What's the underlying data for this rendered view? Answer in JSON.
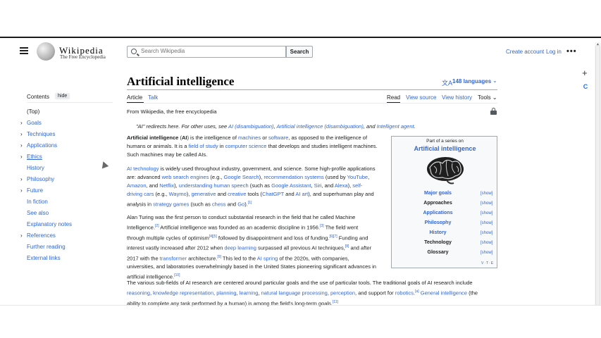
{
  "header": {
    "logo_word": "Wikipedia",
    "logo_tagline": "The Free Encyclopedia",
    "search_placeholder": "Search Wikipedia",
    "search_button": "Search",
    "create_account": "Create account",
    "login": "Log in",
    "more": "•••"
  },
  "side_tools": {
    "plus": "+",
    "extension": "C"
  },
  "toc": {
    "heading": "Contents",
    "hide": "hide",
    "items": [
      {
        "label": "(Top)",
        "expandable": false
      },
      {
        "label": "Goals",
        "expandable": true
      },
      {
        "label": "Techniques",
        "expandable": true
      },
      {
        "label": "Applications",
        "expandable": true
      },
      {
        "label": "Ethics",
        "expandable": true
      },
      {
        "label": "History",
        "expandable": false
      },
      {
        "label": "Philosophy",
        "expandable": true
      },
      {
        "label": "Future",
        "expandable": true
      },
      {
        "label": "In fiction",
        "expandable": false
      },
      {
        "label": "See also",
        "expandable": false
      },
      {
        "label": "Explanatory notes",
        "expandable": false
      },
      {
        "label": "References",
        "expandable": true
      },
      {
        "label": "Further reading",
        "expandable": false
      },
      {
        "label": "External links",
        "expandable": false
      }
    ]
  },
  "article": {
    "title": "Artificial intelligence",
    "languages": "148 languages",
    "tabs": {
      "article": "Article",
      "talk": "Talk",
      "read": "Read",
      "view_source": "View source",
      "view_history": "View history",
      "tools": "Tools"
    },
    "from": "From Wikipedia, the free encyclopedia",
    "hatnote": {
      "prefix": "\"AI\" redirects here. For other uses, see ",
      "link1": "AI (disambiguation)",
      "sep1": ", ",
      "link2": "Artificial intelligence (disambiguation)",
      "sep2": ", and ",
      "link3": "Intelligent agent",
      "suffix": "."
    },
    "p1": {
      "bold": "Artificial intelligence",
      "t1": " (",
      "bold2": "AI",
      "t2": ") is the intelligence of ",
      "l1": "machines",
      "t3": " or ",
      "l2": "software",
      "t4": ", as opposed to the intelligence of",
      "t5": "humans or animals. It is a ",
      "l3": "field of study",
      "t6": " in ",
      "l4": "computer science",
      "t7": " that develops and studies intelligent machines.",
      "t8": "Such machines may be called AIs."
    },
    "p2": {
      "l1": "AI technology",
      "t1": " is widely used throughout industry, government, and science. Some high-profile applications",
      "t2": "are: advanced ",
      "l2": "web search engines",
      "t3": " (e.g., ",
      "l3": "Google Search",
      "t4": "), ",
      "l4": "recommendation systems",
      "t5": " (used by ",
      "l5": "YouTube",
      "t6": ",",
      "l6": "Amazon",
      "t7": ", and ",
      "l7": "Netflix",
      "t8": "), ",
      "l8": "understanding human speech",
      "t9": " (such as ",
      "l9": "Google Assistant",
      "t10": ", ",
      "l10": "Siri",
      "t11": ", and ",
      "l11": "Alexa",
      "t12": "), ",
      "l12": "self-",
      "l13": "driving cars",
      "t13": " (e.g., ",
      "l14": "Waymo",
      "t14": "), ",
      "l15": "generative",
      "t15": " and ",
      "l16": "creative",
      "t16": " tools (",
      "l17": "ChatGPT",
      "t17": " and ",
      "l18": "AI art",
      "t18": "), and superhuman play and",
      "t19": "analysis in ",
      "l19": "strategy games",
      "t20": " (such as ",
      "l20": "chess",
      "t21": " and ",
      "l21": "Go",
      "t22": ").",
      "ref": "[1]"
    },
    "p3": {
      "t1": "Alan Turing was the first person to conduct substantial research in the field that he called Machine",
      "t2": "Intelligence.",
      "r1": "[2]",
      "t3": " Artificial intelligence was founded as an academic discipline in 1956.",
      "r2": "[3]",
      "t4": " The field went",
      "t5": "through multiple cycles of optimism",
      "r3": "[4][5]",
      "t6": " followed by disappointment and loss of funding.",
      "r4": "[6][7]",
      "t7": " Funding and",
      "t8": "interest vastly increased after 2012 when ",
      "l1": "deep learning",
      "t9": " surpassed all previous AI techniques,",
      "r5": "[8]",
      "t10": " and after",
      "t11": "2017 with the ",
      "l2": "transformer",
      "t12": " architecture.",
      "r6": "[9]",
      "t13": " This led to the ",
      "l3": "AI spring",
      "t14": " of the 2020s, with companies,",
      "t15": "universities, and laboratories overwhelmingly based in the United States pioneering significant advances in",
      "t16": "artificial intelligence.",
      "r7": "[10]"
    },
    "p4": {
      "t1": "The various sub-fields of AI research are centered around particular goals and the use of particular tools. The traditional goals of AI research include",
      "l1": "reasoning",
      "s1": ", ",
      "l2": "knowledge representation",
      "s2": ", ",
      "l3": "planning",
      "s3": ", ",
      "l4": "learning",
      "s4": ", ",
      "l5": "natural language processing",
      "s5": ", ",
      "l6": "perception",
      "t2": ", and support for ",
      "l7": "robotics",
      "t3": ".",
      "r1": "[a]",
      "l8": "General intelligence",
      "t4": " (the",
      "t5": "ability to complete any task performed by a human) is among the field's long-term goals.",
      "r2": "[11]"
    }
  },
  "infobox": {
    "series": "Part of a series on",
    "title": "Artificial intelligence",
    "rows": [
      {
        "label": "Major goals",
        "show": "[show]",
        "link": true
      },
      {
        "label": "Approaches",
        "show": "[show]",
        "link": false
      },
      {
        "label": "Applications",
        "show": "[show]",
        "link": true
      },
      {
        "label": "Philosophy",
        "show": "[show]",
        "link": true
      },
      {
        "label": "History",
        "show": "[show]",
        "link": true
      },
      {
        "label": "Technology",
        "show": "[show]",
        "link": false
      },
      {
        "label": "Glossary",
        "show": "[show]",
        "link": false
      }
    ],
    "vte": "V·T·E"
  }
}
